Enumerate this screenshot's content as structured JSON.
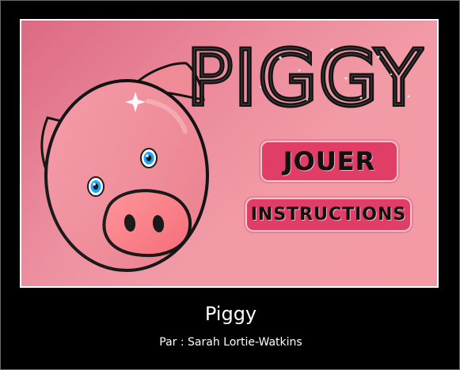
{
  "game": {
    "logo_text": "PIGGY",
    "buttons": {
      "play": "JOUER",
      "instructions": "INSTRUCTIONS"
    },
    "icons": {
      "pig": "pig-icon",
      "sparkle": "sparkle-icon"
    },
    "colors": {
      "panel_background": "#f39aa5",
      "button_background": "#e13e67",
      "text_dark": "#111111",
      "caption_text": "#ffffff"
    }
  },
  "caption": {
    "title": "Piggy",
    "author": "Par : Sarah Lortie-Watkins"
  }
}
